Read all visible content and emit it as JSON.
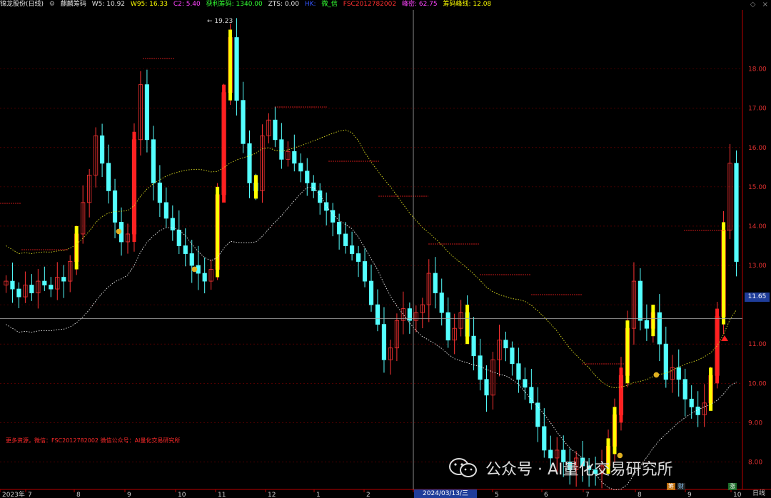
{
  "header": {
    "stock_name": "锦龙股份(日线)",
    "indicator_name": "麒麟筹码",
    "w5": "W5: 10.92",
    "w95": "W95: 16.33",
    "c2": "C2: 5.40",
    "profit_chip": "获利筹码: 1340.00",
    "zts": "ZTS: 0.00",
    "hk": "HK:",
    "weixin": "微_信",
    "fsc": "FSC2012782002",
    "peak_density": "峰密: 62.75",
    "chip_peak_line": "筹码峰线: 12.08",
    "colors": {
      "stock_name": "#e6e6e6",
      "indicator_name": "#e6e6e6",
      "w5": "#e6e6e6",
      "w95": "#ffff00",
      "c2": "#ff44ff",
      "profit_chip": "#33ff33",
      "zts": "#e6e6e6",
      "hk": "#3355ff",
      "weixin": "#33ff33",
      "fsc": "#ff3030",
      "peak_density": "#ff44ff",
      "chip_peak_line": "#ffff00"
    }
  },
  "price_axis": {
    "labels": [
      "18.00",
      "17.00",
      "16.00",
      "15.00",
      "14.00",
      "13.00",
      "11.00",
      "10.00",
      "9.00",
      "8.00"
    ],
    "current_price": "11.65"
  },
  "chart": {
    "high_label": "19.23",
    "crosshair_date": "2024/03/13/三",
    "period": "日线"
  },
  "time_axis": {
    "labels": [
      "2023年",
      "7",
      "8",
      "9",
      "10",
      "11",
      "12",
      "1",
      "2",
      "3",
      "4",
      "5",
      "6",
      "7",
      "8",
      "9",
      "10"
    ]
  },
  "chart_data": {
    "type": "candlestick",
    "y_range": [
      7.3,
      19.5
    ],
    "price_ticks": [
      8,
      9,
      10,
      11,
      12,
      13,
      14,
      15,
      16,
      17,
      18
    ],
    "current_price": 11.65,
    "high_point": 19.23,
    "months": [
      "2023年",
      "7",
      "8",
      "9",
      "10",
      "11",
      "12",
      "1",
      "2",
      "3",
      "4",
      "5",
      "6",
      "7",
      "8",
      "9",
      "10"
    ],
    "closes": [
      12.6,
      12.4,
      12.2,
      12.5,
      12.3,
      12.6,
      12.5,
      12.4,
      12.7,
      12.6,
      13.1,
      13.8,
      14.6,
      15.3,
      16.3,
      15.6,
      14.9,
      14.1,
      13.6,
      13.8,
      16.2,
      17.6,
      16.2,
      15.1,
      14.6,
      14.2,
      13.9,
      13.5,
      13.3,
      13.0,
      12.8,
      12.6,
      12.9,
      14.8,
      17.4,
      18.8,
      17.2,
      16.1,
      15.1,
      14.9,
      16.3,
      16.7,
      16.2,
      15.7,
      15.9,
      15.6,
      15.4,
      15.1,
      14.9,
      14.6,
      14.4,
      14.1,
      13.8,
      13.5,
      13.3,
      13.1,
      12.6,
      12.0,
      11.5,
      10.6,
      10.9,
      11.6,
      11.9,
      11.6,
      11.8,
      12.0,
      12.8,
      12.3,
      11.8,
      11.1,
      11.4,
      11.8,
      11.2,
      10.7,
      10.1,
      9.7,
      10.6,
      11.1,
      10.9,
      10.5,
      10.1,
      9.9,
      9.5,
      8.9,
      8.3,
      8.1,
      8.3,
      8.0,
      7.8,
      8.1,
      7.9,
      7.8,
      7.7,
      7.9,
      8.4,
      9.2,
      10.2,
      11.4,
      12.6,
      11.6,
      11.4,
      11.8,
      11.0,
      10.1,
      10.4,
      10.1,
      9.6,
      9.4,
      9.2,
      9.5,
      10.2,
      11.7,
      13.9,
      15.6,
      13.1
    ],
    "ma_volume_weighted": "dotted_yellow",
    "chip_peak_line_value": 12.08,
    "annotations": {
      "red_info": "更多资源，微信：FSC2012782002 微信公众号：AI量化交易研究所"
    }
  },
  "footer": {
    "watermark": "公众号 · AI量化交易研究所",
    "badge1": "筹",
    "badge2": "财",
    "badge3": "涨"
  }
}
